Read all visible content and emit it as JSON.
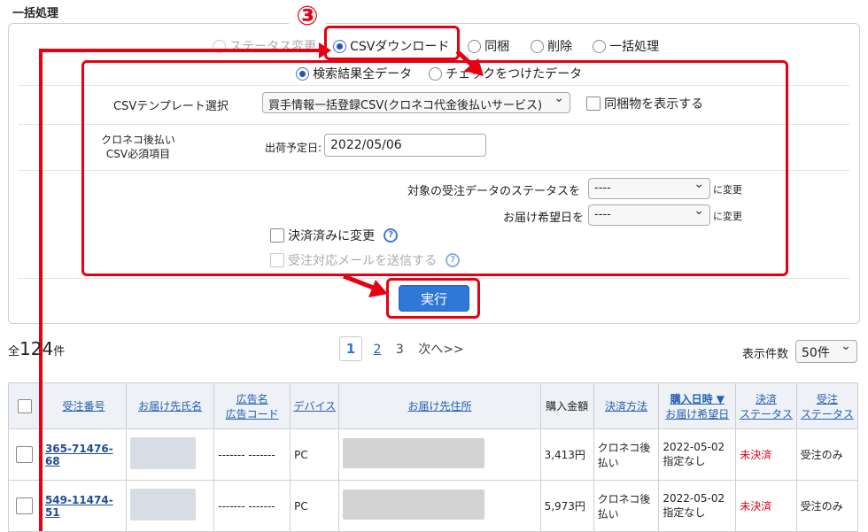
{
  "section_title": "一括処理",
  "step_number": "③",
  "modes": [
    {
      "label": "ステータス変更",
      "selected": false
    },
    {
      "label": "CSVダウンロード",
      "selected": true
    },
    {
      "label": "同梱",
      "selected": false
    },
    {
      "label": "削除",
      "selected": false
    },
    {
      "label": "一括処理",
      "selected": false
    }
  ],
  "targets": [
    {
      "label": "検索結果全データ",
      "selected": true
    },
    {
      "label": "チェックをつけたデータ",
      "selected": false
    }
  ],
  "template": {
    "label": "CSVテンプレート選択",
    "value": "買手情報一括登録CSV(クロネコ代金後払いサービス)"
  },
  "show_bundle_label": "同梱物を表示する",
  "kuroneko": {
    "label_line1": "クロネコ後払い",
    "label_line2": "CSV必須項目",
    "ship_date_label": "出荷予定日:",
    "ship_date_value": "2022/05/06"
  },
  "status_row": {
    "label": "対象の受注データのステータスを",
    "value": "----",
    "suffix": "に変更"
  },
  "delivery_row": {
    "label": "お届け希望日を",
    "value": "----",
    "suffix": "に変更"
  },
  "settled_label": "決済済みに変更",
  "send_mail_label": "受注対応メールを送信する",
  "help_icon": "?",
  "execute_label": "実行",
  "total": {
    "prefix": "全",
    "count": "124",
    "suffix": "件"
  },
  "pager": {
    "current": "1",
    "p2": "2",
    "p3": "3",
    "next": "次へ>>"
  },
  "per_page": {
    "label": "表示件数",
    "value": "50件"
  },
  "table": {
    "headers": {
      "order_no": "受注番号",
      "name": "お届け先氏名",
      "ad_l1": "広告名",
      "ad_l2": "広告コード",
      "device": "デバイス",
      "address": "お届け先住所",
      "amount": "購入金額",
      "payment": "決済方法",
      "date_l1": "購入日時 ▼",
      "date_l2": "お届け希望日",
      "settle_l1": "決済",
      "settle_l2": "ステータス",
      "order_l1": "受注",
      "order_l2": "ステータス"
    },
    "rows": [
      {
        "order_no": "365-71476-68",
        "ad": "------- -------",
        "device": "PC",
        "amount": "3,413円",
        "payment": "クロネコ後払い",
        "date": "2022-05-02",
        "delivery": "指定なし",
        "settle": "未決済",
        "status": "受注のみ"
      },
      {
        "order_no": "549-11474-51",
        "ad": "------- -------",
        "device": "PC",
        "amount": "5,973円",
        "payment": "クロネコ後払い",
        "date": "2022-05-02",
        "delivery": "指定なし",
        "settle": "未決済",
        "status": "受注のみ"
      }
    ]
  },
  "colors": {
    "annotation_red": "#e60012",
    "primary_blue": "#2f78d8",
    "link_blue": "#2460b0"
  }
}
